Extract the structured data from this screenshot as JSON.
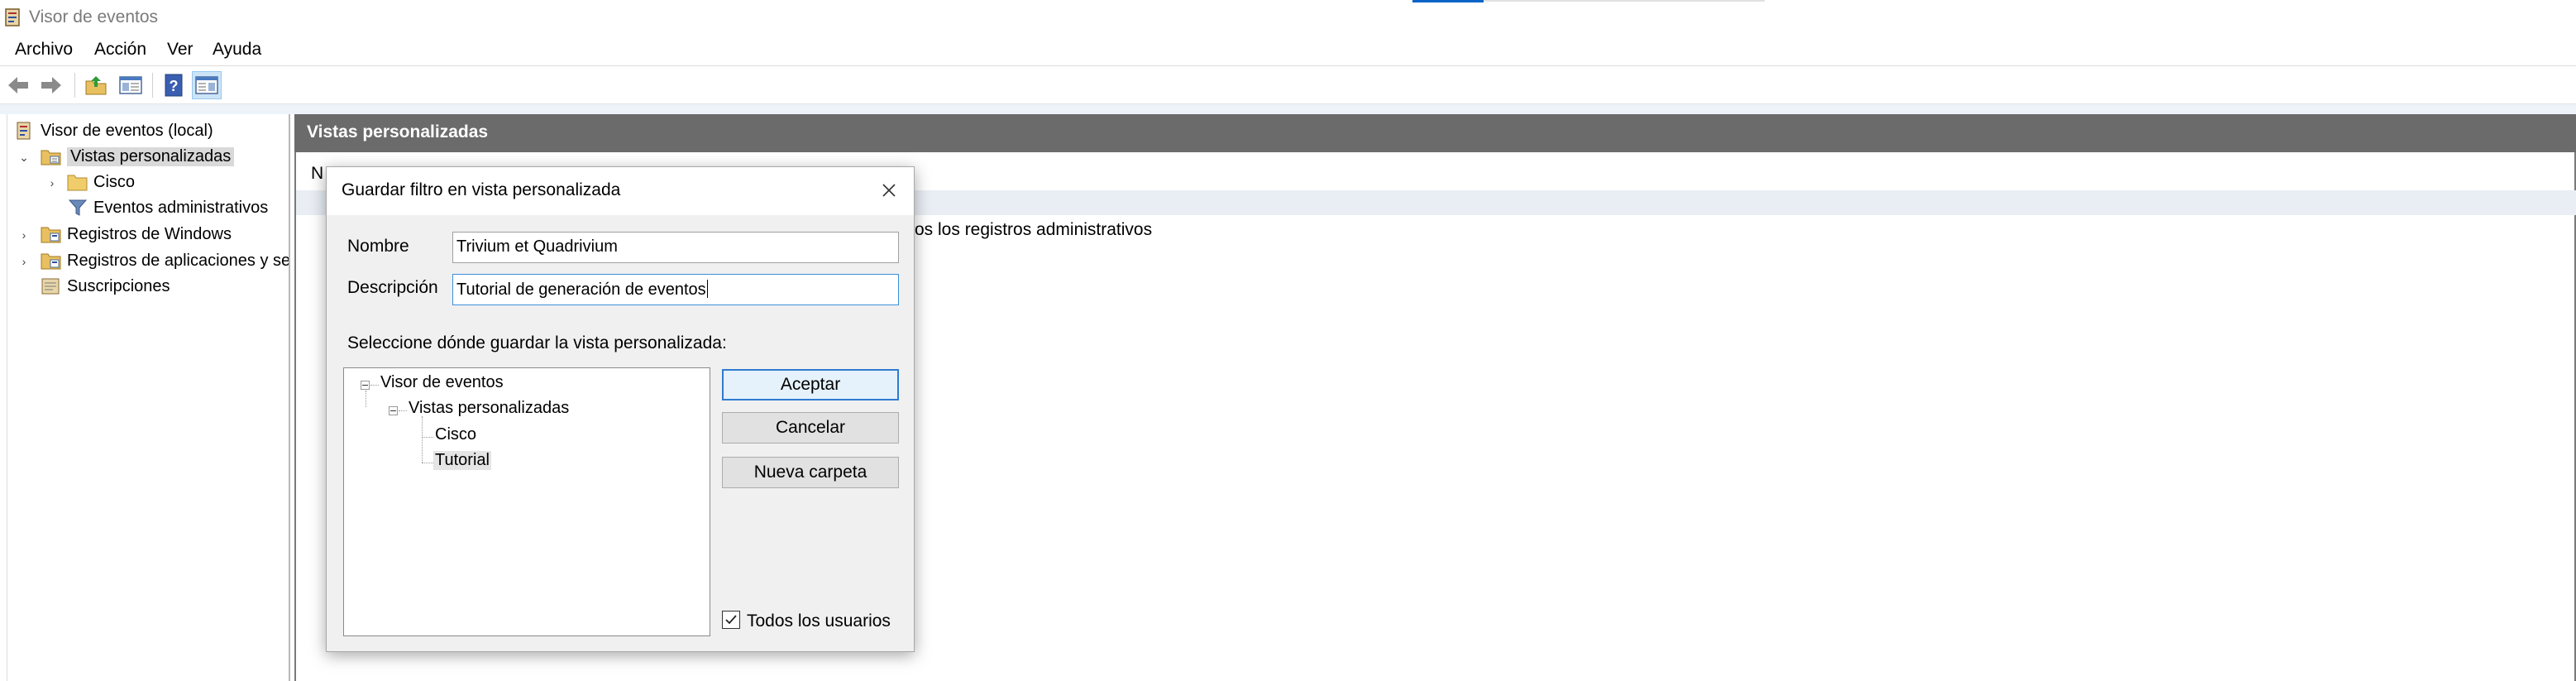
{
  "window": {
    "title": "Visor de eventos"
  },
  "menu": [
    "Archivo",
    "Acción",
    "Ver",
    "Ayuda"
  ],
  "toolbar": {
    "buttons": [
      "back-icon",
      "forward-icon",
      "up-folder-icon",
      "show-hide-console-tree-icon",
      "help-icon",
      "show-hide-action-pane-icon"
    ]
  },
  "tree": {
    "root": "Visor de eventos (local)",
    "items": [
      {
        "label": "Vistas personalizadas",
        "expanded": true,
        "selected": true
      },
      {
        "label": "Cisco"
      },
      {
        "label": "Eventos administrativos"
      },
      {
        "label": "Registros de Windows"
      },
      {
        "label": "Registros de aplicaciones y se"
      },
      {
        "label": "Suscripciones"
      }
    ]
  },
  "main": {
    "header": "Vistas personalizadas",
    "column_header_partial": "N",
    "row_text": "os los registros administrativos"
  },
  "dialog": {
    "title": "Guardar filtro en vista personalizada",
    "name_label": "Nombre",
    "name_value": "Trivium et Quadrivium",
    "description_label": "Descripción",
    "description_value": "Tutorial de generación de eventos",
    "location_prompt": "Seleccione dónde guardar la vista personalizada:",
    "tree": {
      "root": "Visor de eventos",
      "child": "Vistas personalizadas",
      "leaves": [
        "Cisco",
        "Tutorial"
      ],
      "selected": "Tutorial"
    },
    "ok_label": "Aceptar",
    "cancel_label": "Cancelar",
    "new_folder_label": "Nueva carpeta",
    "all_users_label": "Todos los usuarios",
    "all_users_checked": true
  },
  "colors": {
    "header_bg": "#6b6b6b",
    "selection": "#d9d9d9",
    "accent": "#2f7bd0"
  }
}
